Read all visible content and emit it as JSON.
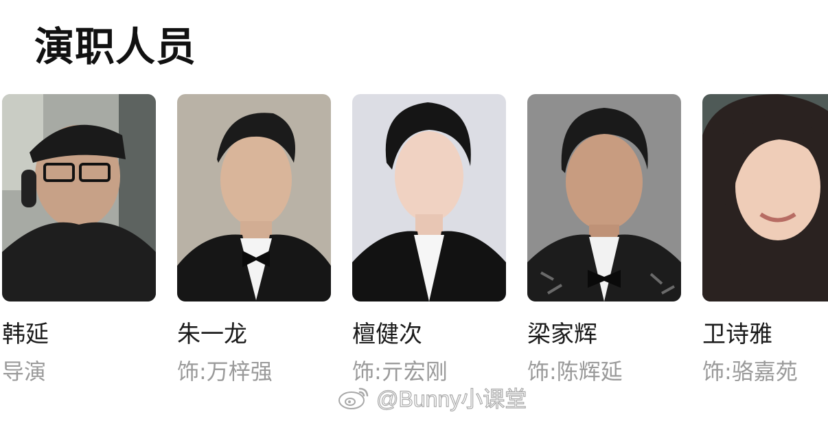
{
  "section": {
    "title": "演职人员"
  },
  "cast": [
    {
      "name": "韩延",
      "role": "导演",
      "photo_icon": "director-portrait"
    },
    {
      "name": "朱一龙",
      "role": "饰:万梓强",
      "photo_icon": "actor-portrait"
    },
    {
      "name": "檀健次",
      "role": "饰:亓宏刚",
      "photo_icon": "actor-portrait"
    },
    {
      "name": "梁家辉",
      "role": "饰:陈辉延",
      "photo_icon": "actor-portrait"
    },
    {
      "name": "卫诗雅",
      "role": "饰:骆嘉苑",
      "photo_icon": "actress-portrait"
    }
  ],
  "watermark": {
    "text": "@Bunny小课堂",
    "icon": "weibo-logo"
  },
  "colors": {
    "title": "#111111",
    "name": "#1a1a1a",
    "role": "#9a9a9a"
  }
}
